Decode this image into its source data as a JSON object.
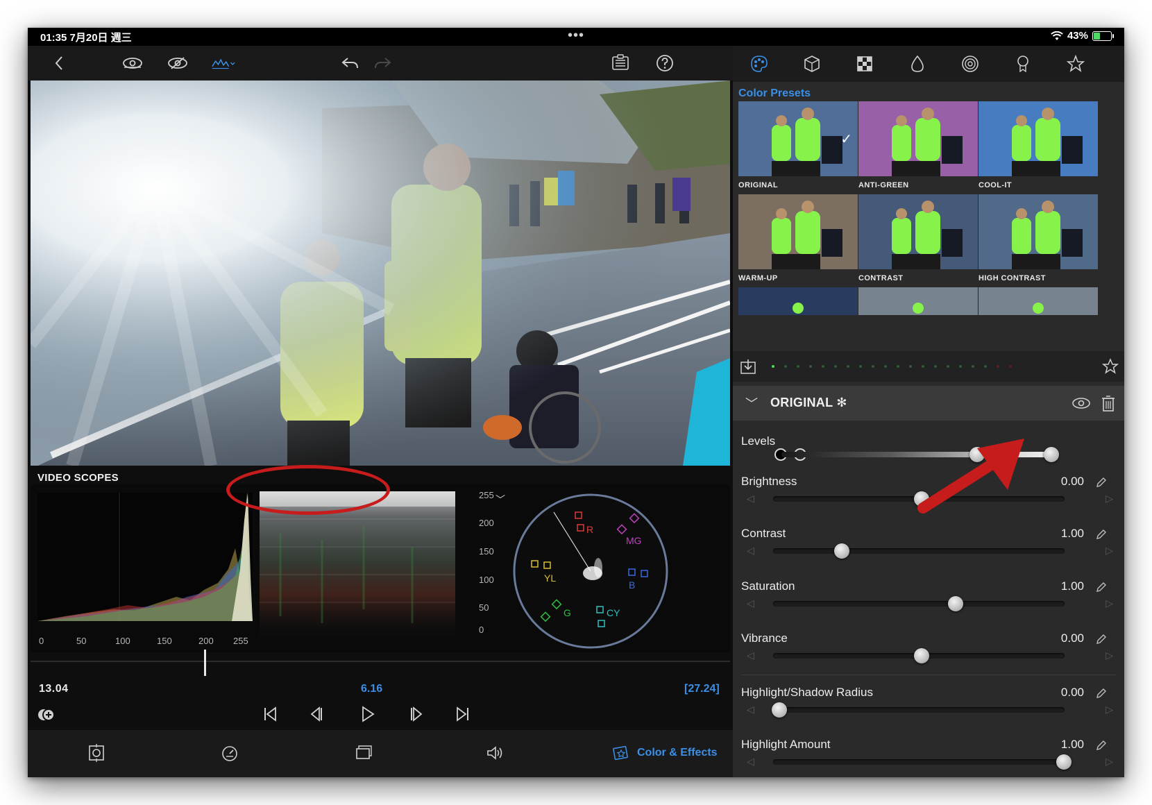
{
  "status_bar": {
    "time_date": "01:35  7月20日 週三",
    "dots": "•••",
    "battery_percent": "43%",
    "battery_level": 0.43
  },
  "video_scopes": {
    "title": "VIDEO SCOPES",
    "histogram_ticks": [
      "0",
      "50",
      "100",
      "150",
      "200",
      "255"
    ],
    "waveform_ticks": [
      "255",
      "200",
      "150",
      "100",
      "50",
      "0"
    ],
    "vectorscope_labels": [
      "R",
      "MG",
      "YL",
      "B",
      "G",
      "CY"
    ]
  },
  "timeline": {
    "current_time": "13.04",
    "clip_time": "6.16",
    "duration": "[27.24]"
  },
  "bottom_bar": {
    "active_label": "Color & Effects"
  },
  "color_presets": {
    "header": "Color Presets",
    "items": [
      {
        "label": "ORIGINAL",
        "selected": true,
        "tint": "#3a5a8a"
      },
      {
        "label": "ANTI-GREEN",
        "selected": false,
        "tint": "#8a4a9a"
      },
      {
        "label": "COOL-IT",
        "selected": false,
        "tint": "#2e6ab8"
      },
      {
        "label": "WARM-UP",
        "selected": false,
        "tint": "#6a5a4a"
      },
      {
        "label": "CONTRAST",
        "selected": false,
        "tint": "#2c4466"
      },
      {
        "label": "HIGH CONTRAST",
        "selected": false,
        "tint": "#3a567a"
      }
    ]
  },
  "adjustments": {
    "section_title": "ORIGINAL ✻",
    "levels_label": "Levels",
    "params": [
      {
        "label": "Brightness",
        "value": "0.00",
        "position": 0.5
      },
      {
        "label": "Contrast",
        "value": "1.00",
        "position": 0.22
      },
      {
        "label": "Saturation",
        "value": "1.00",
        "position": 0.62
      },
      {
        "label": "Vibrance",
        "value": "0.00",
        "position": 0.5
      },
      {
        "label": "Highlight/Shadow Radius",
        "value": "0.00",
        "position": 0.0
      },
      {
        "label": "Highlight Amount",
        "value": "1.00",
        "position": 1.0
      }
    ]
  },
  "colors": {
    "accent_blue": "#3b8fe6",
    "annotation_red": "#c71c1c",
    "active_green": "#4cd964"
  }
}
